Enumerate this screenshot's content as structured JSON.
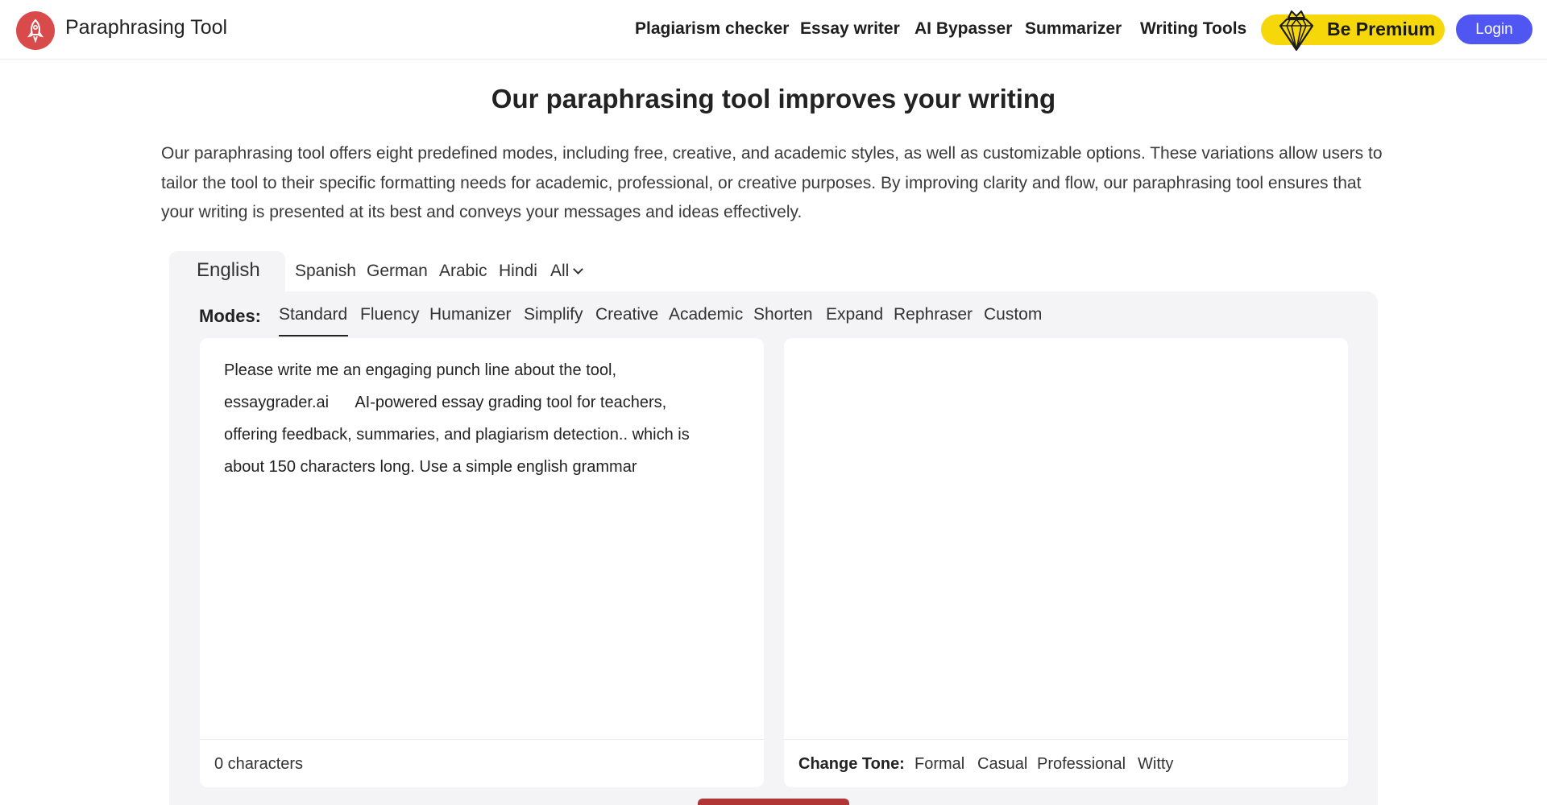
{
  "header": {
    "brand": "Paraphrasing Tool",
    "nav": [
      "Plagiarism checker",
      "Essay writer",
      "AI Bypasser",
      "Summarizer",
      "Writing Tools"
    ],
    "premium_label": "Be Premium",
    "login_label": "Login"
  },
  "hero": {
    "title": "Our paraphrasing tool improves your writing",
    "description": "Our paraphrasing tool offers eight predefined modes, including free, creative, and academic styles, as well as customizable options. These variations allow users to tailor the tool to their specific formatting needs for academic, professional, or creative purposes. By improving clarity and flow, our paraphrasing tool ensures that your writing is presented at its best and conveys your messages and ideas effectively."
  },
  "languages": {
    "active": "English",
    "others": [
      "Spanish",
      "German",
      "Arabic",
      "Hindi"
    ],
    "all_label": "All"
  },
  "modes": {
    "label": "Modes:",
    "items": [
      "Standard",
      "Fluency",
      "Humanizer",
      "Simplify",
      "Creative",
      "Academic",
      "Shorten",
      "Expand",
      "Rephraser",
      "Custom"
    ],
    "selected": "Standard"
  },
  "input": {
    "text": "Please write me an engaging punch line about the tool,\nessaygrader.ai      AI-powered essay grading tool for teachers,\noffering feedback, summaries, and plagiarism detection.. which is\nabout 150 characters long. Use a simple english grammar",
    "char_count": "0 characters"
  },
  "output": {
    "tone_label": "Change Tone:",
    "tones": [
      "Formal",
      "Casual",
      "Professional",
      "Witty"
    ]
  },
  "colors": {
    "brand_red": "#d94a4a",
    "premium_yellow": "#f6d70a",
    "login_blue": "#4f56f2",
    "panel_gray": "#f4f4f6"
  }
}
